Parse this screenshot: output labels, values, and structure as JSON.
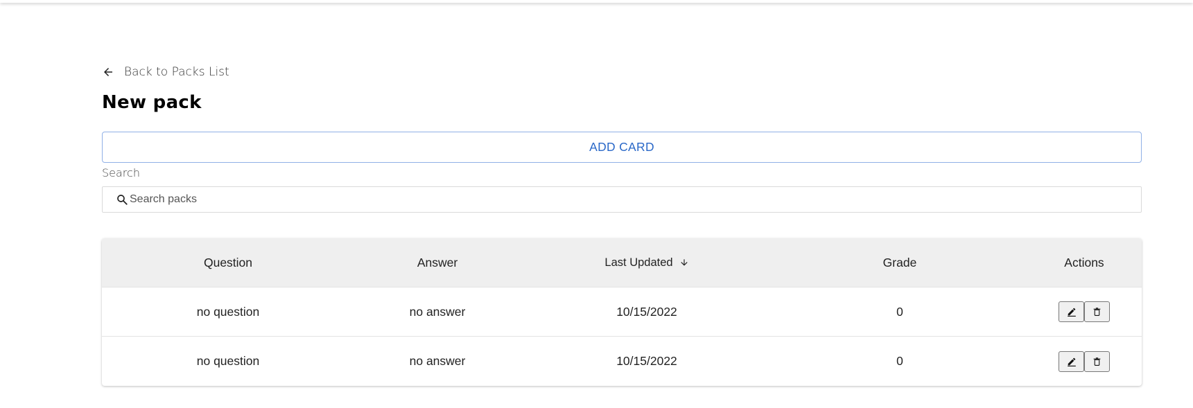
{
  "nav": {
    "back_label": "Back to Packs List"
  },
  "page": {
    "title": "New pack"
  },
  "toolbar": {
    "add_card_label": "ADD CARD"
  },
  "search": {
    "label": "Search",
    "placeholder": "Search packs",
    "value": ""
  },
  "table": {
    "columns": [
      "Question",
      "Answer",
      "Last Updated",
      "Grade",
      "Actions"
    ],
    "sort": {
      "column": "Last Updated",
      "direction": "desc",
      "icon": "arrow-down-icon"
    },
    "rows": [
      {
        "question": "no question",
        "answer": "no answer",
        "updated": "10/15/2022",
        "grade": "0"
      },
      {
        "question": "no question",
        "answer": "no answer",
        "updated": "10/15/2022",
        "grade": "0"
      }
    ],
    "row_actions": [
      "edit-icon",
      "trash-icon"
    ]
  },
  "colors": {
    "accent": "#2a68c8",
    "accent_border": "#8fb0e6",
    "header_bg": "#efefef"
  }
}
